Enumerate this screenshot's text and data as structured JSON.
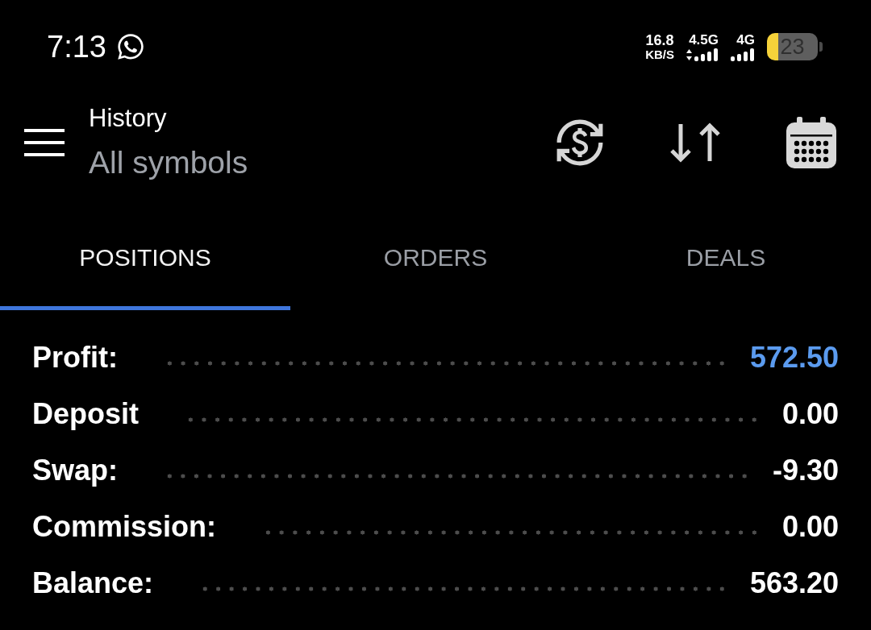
{
  "status_bar": {
    "time": "7:13",
    "net_speed": {
      "value": "16.8",
      "unit": "KB/S"
    },
    "networks": [
      {
        "label": "4.5G",
        "activity": true
      },
      {
        "label": "4G",
        "activity": false
      }
    ],
    "battery": "23"
  },
  "header": {
    "title": "History",
    "subtitle": "All symbols"
  },
  "tabs": [
    {
      "label": "POSITIONS",
      "selected": true
    },
    {
      "label": "ORDERS",
      "selected": false
    },
    {
      "label": "DEALS",
      "selected": false
    }
  ],
  "summary": [
    {
      "label": "Profit:",
      "value": "572.50",
      "highlighted": true
    },
    {
      "label": "Deposit",
      "value": "0.00",
      "highlighted": false
    },
    {
      "label": "Swap:",
      "value": "-9.30",
      "highlighted": false
    },
    {
      "label": "Commission:",
      "value": "0.00",
      "highlighted": false
    },
    {
      "label": "Balance:",
      "value": "563.20",
      "highlighted": false
    }
  ]
}
